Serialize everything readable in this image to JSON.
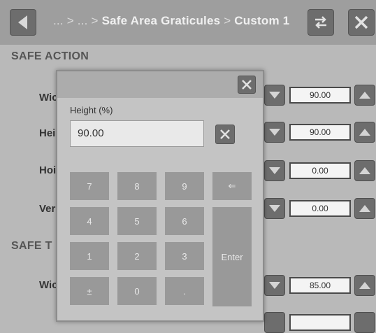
{
  "breadcrumb": {
    "parent_1": "...",
    "separator": ">",
    "parent_2": "...",
    "section": "Safe Area Graticules",
    "current": "Custom 1"
  },
  "icons": {
    "back": "triangle-left-icon",
    "swap": "swap-arrows-icon",
    "close": "close-icon"
  },
  "safe_action": {
    "title": "SAFE ACTION",
    "rows": [
      {
        "label": "Wic",
        "value": "90.00"
      },
      {
        "label": "Hei",
        "value": "90.00"
      },
      {
        "label": "Hoi",
        "value": "0.00"
      },
      {
        "label": "Ver",
        "value": "0.00"
      }
    ]
  },
  "safe_title": {
    "title": "SAFE T",
    "rows": [
      {
        "label": "Wic",
        "value": "85.00"
      }
    ]
  },
  "dialog": {
    "label": "Height (%)",
    "value": "90.00",
    "keys": [
      "7",
      "8",
      "9",
      "⇐",
      "4",
      "5",
      "6",
      "1",
      "2",
      "3",
      "±",
      "0",
      "."
    ],
    "enter_label": "Enter"
  },
  "colors": {
    "background": "#b9b9b9",
    "topbar": "#9e9e9e",
    "button": "#6d6d6d",
    "key": "#999999"
  }
}
